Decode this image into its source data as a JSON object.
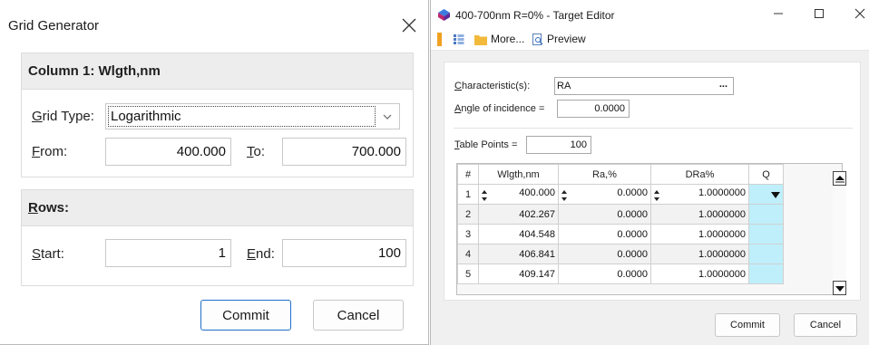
{
  "grid_generator": {
    "title": "Grid Generator",
    "column_section": {
      "heading": "Column 1: Wlgth,nm",
      "grid_type_label_prefix": "G",
      "grid_type_label_rest": "rid Type:",
      "grid_type_value": "Logarithmic",
      "from_label_prefix": "F",
      "from_label_rest": "rom:",
      "from_value": "400.000",
      "to_label_prefix": "T",
      "to_label_rest": "o:",
      "to_value": "700.000"
    },
    "rows_section": {
      "heading_prefix": "R",
      "heading_rest": "ows:",
      "start_label_prefix": "S",
      "start_label_rest": "tart:",
      "start_value": "1",
      "end_label_prefix": "E",
      "end_label_rest": "nd:",
      "end_value": "100"
    },
    "commit_label": "Commit",
    "cancel_label": "Cancel"
  },
  "target_editor": {
    "title": "400-700nm R=0% - Target Editor",
    "toolbar": {
      "more_label": "More...",
      "preview_label": "Preview"
    },
    "characteristic_label_prefix": "C",
    "characteristic_label_rest": "haracteristic(s):",
    "characteristic_value": "RA",
    "characteristic_more": "...",
    "angle_label_prefix": "A",
    "angle_label_rest": "ngle of incidence =",
    "angle_value": "0.0000",
    "table_points_label_prefix": "T",
    "table_points_label_rest": "able Points =",
    "table_points_value": "100",
    "columns": [
      "#",
      "Wlgth,nm",
      "Ra,%",
      "DRa%",
      "Q"
    ],
    "rows": [
      {
        "n": "1",
        "wl": "400.000",
        "ra": "0.0000",
        "dra": "1.0000000"
      },
      {
        "n": "2",
        "wl": "402.267",
        "ra": "0.0000",
        "dra": "1.0000000"
      },
      {
        "n": "3",
        "wl": "404.548",
        "ra": "0.0000",
        "dra": "1.0000000"
      },
      {
        "n": "4",
        "wl": "406.841",
        "ra": "0.0000",
        "dra": "1.0000000"
      },
      {
        "n": "5",
        "wl": "409.147",
        "ra": "0.0000",
        "dra": "1.0000000"
      }
    ],
    "commit_label": "Commit",
    "cancel_label": "Cancel"
  },
  "colors": {
    "accent": "#1f6fc8",
    "q_cell": "#bfeffb",
    "section_header": "#ededed"
  }
}
